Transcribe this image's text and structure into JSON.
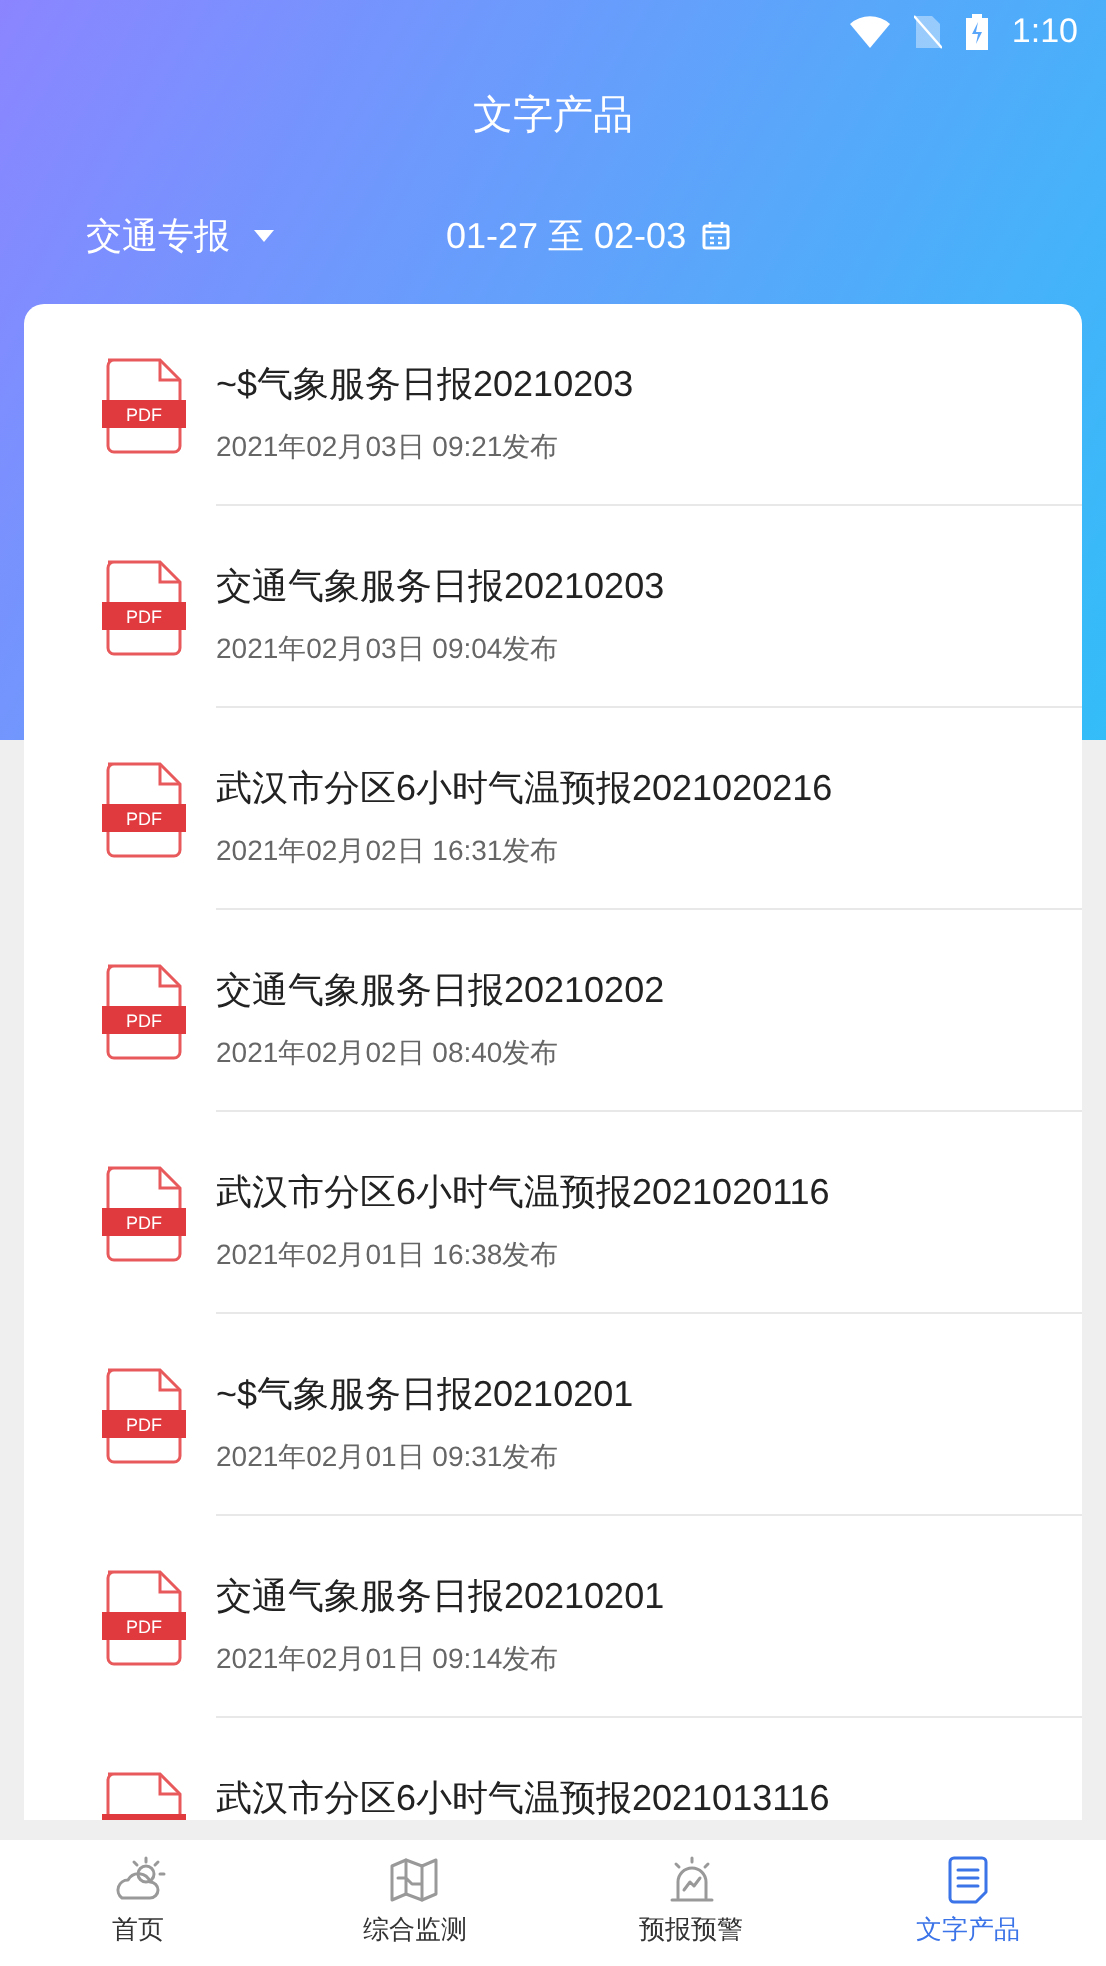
{
  "status_bar": {
    "time": "1:10"
  },
  "header": {
    "title": "文字产品"
  },
  "filter": {
    "category": "交通专报",
    "date_range": "01-27 至 02-03"
  },
  "documents": [
    {
      "title": "~$气象服务日报20210203",
      "published": "2021年02月03日 09:21发布",
      "pdf_label": "PDF"
    },
    {
      "title": "交通气象服务日报20210203",
      "published": "2021年02月03日 09:04发布",
      "pdf_label": "PDF"
    },
    {
      "title": "武汉市分区6小时气温预报2021020216",
      "published": "2021年02月02日 16:31发布",
      "pdf_label": "PDF"
    },
    {
      "title": "交通气象服务日报20210202",
      "published": "2021年02月02日 08:40发布",
      "pdf_label": "PDF"
    },
    {
      "title": "武汉市分区6小时气温预报2021020116",
      "published": "2021年02月01日 16:38发布",
      "pdf_label": "PDF"
    },
    {
      "title": "~$气象服务日报20210201",
      "published": "2021年02月01日 09:31发布",
      "pdf_label": "PDF"
    },
    {
      "title": "交通气象服务日报20210201",
      "published": "2021年02月01日 09:14发布",
      "pdf_label": "PDF"
    },
    {
      "title": "武汉市分区6小时气温预报2021013116"
    }
  ],
  "tabs": [
    {
      "label": "首页",
      "kind": "weather",
      "selected": false
    },
    {
      "label": "综合监测",
      "kind": "map",
      "selected": false
    },
    {
      "label": "预报预警",
      "kind": "alarm",
      "selected": false
    },
    {
      "label": "文字产品",
      "kind": "document",
      "selected": true
    }
  ]
}
